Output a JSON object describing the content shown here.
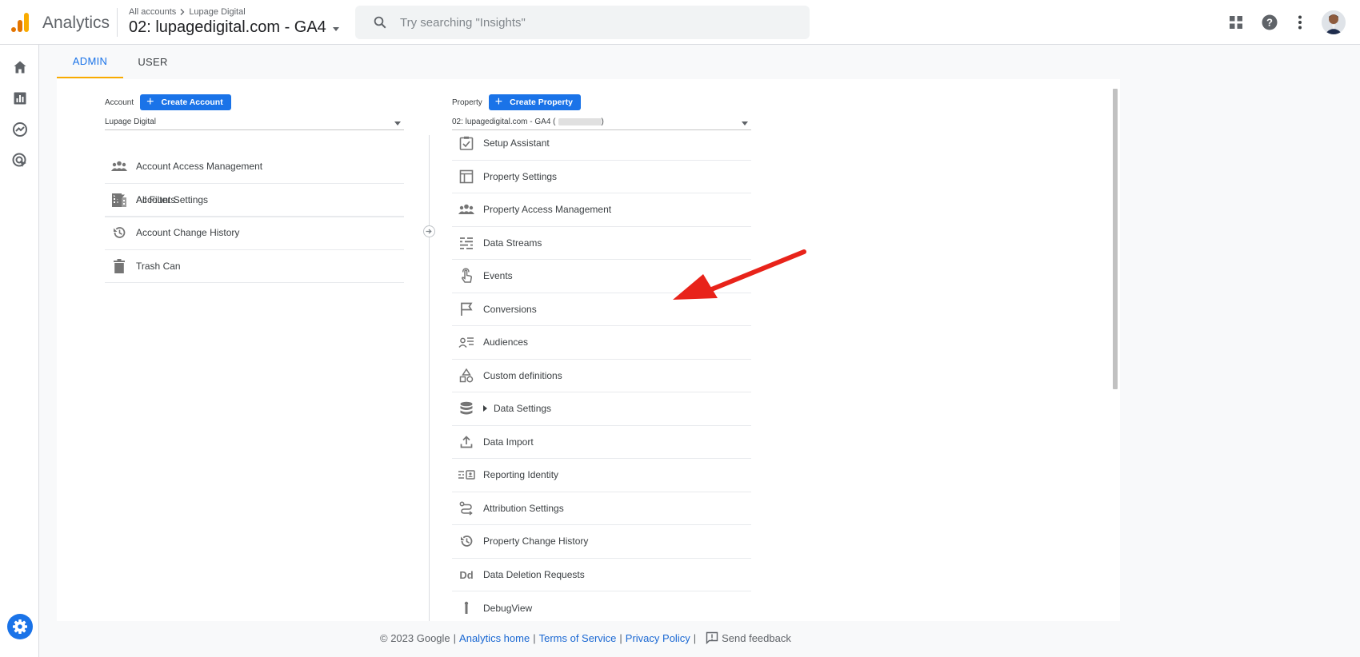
{
  "header": {
    "app_name": "Analytics",
    "breadcrumb": {
      "root": "All accounts",
      "account": "Lupage Digital"
    },
    "property_title": "02: lupagedigital.com - GA4",
    "search_placeholder": "Try searching \"Insights\"",
    "icons": [
      "apps-grid-icon",
      "help-icon",
      "more-vert-icon",
      "avatar"
    ]
  },
  "rail": {
    "items": [
      "home-icon",
      "reports-icon",
      "explore-icon",
      "advertising-icon"
    ],
    "admin": "gear-icon"
  },
  "tabs": [
    {
      "label": "ADMIN",
      "active": true
    },
    {
      "label": "USER",
      "active": false
    }
  ],
  "account": {
    "label": "Account",
    "create_label": "Create Account",
    "selected": "Lupage Digital",
    "items": [
      {
        "label": "Account Settings",
        "icon": "building-icon"
      },
      {
        "label": "Account Access Management",
        "icon": "people-icon"
      },
      {
        "label": "All Filters",
        "icon": "filter-icon"
      },
      {
        "label": "Account Change History",
        "icon": "history-icon"
      },
      {
        "label": "Trash Can",
        "icon": "trash-icon"
      }
    ]
  },
  "property": {
    "label": "Property",
    "create_label": "Create Property",
    "selected": "02: lupagedigital.com - GA4 (",
    "items": [
      {
        "label": "Setup Assistant",
        "icon": "checklist-icon"
      },
      {
        "label": "Property Settings",
        "icon": "layout-icon"
      },
      {
        "label": "Property Access Management",
        "icon": "people-icon"
      },
      {
        "label": "Data Streams",
        "icon": "streams-icon"
      },
      {
        "label": "Events",
        "icon": "touch-icon"
      },
      {
        "label": "Conversions",
        "icon": "flag-icon"
      },
      {
        "label": "Audiences",
        "icon": "audience-icon"
      },
      {
        "label": "Custom definitions",
        "icon": "shapes-icon"
      },
      {
        "label": "Data Settings",
        "icon": "database-icon"
      },
      {
        "label": "Data Import",
        "icon": "upload-icon"
      },
      {
        "label": "Reporting Identity",
        "icon": "identity-icon"
      },
      {
        "label": "Attribution Settings",
        "icon": "attribution-icon"
      },
      {
        "label": "Property Change History",
        "icon": "history-icon"
      },
      {
        "label": "Data Deletion Requests",
        "icon": "dd-icon"
      },
      {
        "label": "DebugView",
        "icon": "debug-icon"
      }
    ]
  },
  "footer": {
    "copyright": "© 2023 Google",
    "links": [
      "Analytics home",
      "Terms of Service",
      "Privacy Policy"
    ],
    "feedback": "Send feedback"
  },
  "colors": {
    "accent": "#1a73e8",
    "tab_underline": "#f9ab00",
    "annotation_arrow": "#e8231a"
  }
}
